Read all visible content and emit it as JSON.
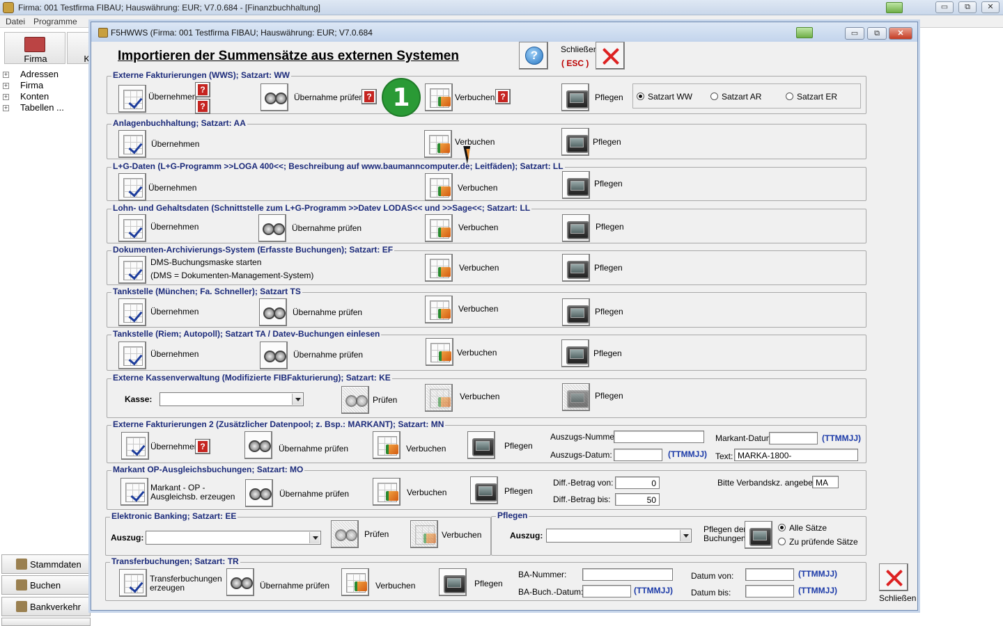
{
  "app": {
    "title": "Firma: 001 Testfirma FIBAU;   Hauswährung: EUR; V7.0.684  - [Finanzbuchhaltung]",
    "menu": [
      "Datei",
      "Programme"
    ],
    "toolbar": {
      "firma": "Firma",
      "k": "K"
    },
    "tree": [
      "Adressen",
      "Firma",
      "Konten",
      "Tabellen ..."
    ],
    "nav": [
      "Stammdaten",
      "Buchen",
      "Bankverkehr"
    ],
    "window_buttons": {
      "min": "▭",
      "restore": "⧉",
      "close": "✕"
    }
  },
  "dialog": {
    "title": "F5HWWS   (Firma: 001 Testfirma FIBAU;   Hauswährung: EUR; V7.0.684",
    "heading": "Importieren der Summensätze aus externen Systemen",
    "help_label": "?",
    "close_label": "Schließen",
    "esc_label": "( ESC )",
    "bottom_close_label": "Schließen",
    "step_badge": "1"
  },
  "common": {
    "uebernehmen": "Übernehmen",
    "uebernahme_pruefen": "Übernahme prüfen",
    "verbuchen": "Verbuchen",
    "pflegen": "Pflegen",
    "pruefen": "Prüfen",
    "ttmmjj": "(TTMMJJ)"
  },
  "groups": {
    "wws": {
      "label": "Externe Fakturierungen (WWS); Satzart: WW",
      "radios": [
        "Satzart WW",
        "Satzart AR",
        "Satzart ER"
      ]
    },
    "aa": {
      "label": "Anlagenbuchhaltung; Satzart: AA"
    },
    "lg": {
      "label": "L+G-Daten (L+G-Programm >>LOGA 400<<; Beschreibung auf www.baumanncomputer.de; Leitfäden); Satzart: LL"
    },
    "lohn": {
      "label": "Lohn- und Gehaltsdaten (Schnittstelle zum L+G-Programm >>Datev LODAS<< und >>Sage<<; Satzart: LL"
    },
    "dms": {
      "label": "Dokumenten-Archivierungs-System (Erfasste Buchungen); Satzart: EF",
      "line1": "DMS-Buchungsmaske starten",
      "line2": "(DMS = Dokumenten-Management-System)"
    },
    "ts": {
      "label": "Tankstelle (München; Fa. Schneller); Satzart TS"
    },
    "ta": {
      "label": "Tankstelle (Riem; Autopoll); Satzart TA / Datev-Buchungen einlesen"
    },
    "ke": {
      "label": "Externe Kassenverwaltung (Modifizierte FIBFakturierung); Satzart: KE",
      "kasse_label": "Kasse:",
      "kasse_value": ""
    },
    "mn": {
      "label": "Externe Fakturierungen 2  (Zusätzlicher Datenpool; z. Bsp.:  MARKANT); Satzart: MN",
      "auszugs_nummer_label": "Auszugs-Nummer:",
      "auszugs_nummer_value": "",
      "auszugs_datum_label": "Auszugs-Datum:",
      "auszugs_datum_value": "",
      "markant_datum_label": "Markant-Datum:",
      "markant_datum_value": "",
      "text_label": "Text:",
      "text_value": "MARKA-1800-"
    },
    "mo": {
      "label": "Markant OP-Ausgleichsbuchungen; Satzart: MO",
      "line1": "Markant - OP -",
      "line2": "Ausgleichsb. erzeugen",
      "diff_von_label": "Diff.-Betrag von:",
      "diff_von_value": "0",
      "diff_bis_label": "Diff.-Betrag bis:",
      "diff_bis_value": "50",
      "verband_label": "Bitte Verbandskz. angeben:",
      "verband_value": "MA"
    },
    "ee": {
      "label": "Elektronic Banking; Satzart: EE",
      "auszug_label": "Auszug:",
      "auszug_value": ""
    },
    "pflegen_box": {
      "label": "Pflegen",
      "auszug_label": "Auszug:",
      "auszug_value": "",
      "pflegen_der_line1": "Pflegen der",
      "pflegen_der_line2": "Buchungen",
      "radios": [
        "Alle Sätze",
        "Zu prüfende Sätze"
      ]
    },
    "tr": {
      "label": "Transferbuchungen; Satzart: TR",
      "line1": "Transferbuchungen",
      "line2": "erzeugen",
      "ba_nummer_label": "BA-Nummer:",
      "ba_nummer_value": "",
      "ba_datum_label": "BA-Buch.-Datum:",
      "ba_datum_value": "",
      "datum_von_label": "Datum von:",
      "datum_von_value": "",
      "datum_bis_label": "Datum bis:",
      "datum_bis_value": ""
    }
  }
}
